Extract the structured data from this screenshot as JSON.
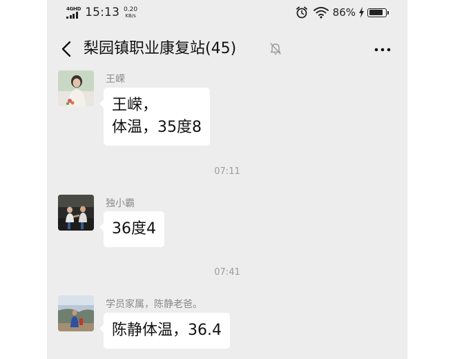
{
  "status_bar": {
    "network": "4GHD",
    "time": "15:13",
    "speed_value": "0.20",
    "speed_unit": "KB/s",
    "battery_percent": "86%",
    "battery_level": 0.86,
    "icons": [
      "signal-icon",
      "alarm-icon",
      "wifi-icon",
      "charging-icon",
      "battery-icon"
    ]
  },
  "nav": {
    "title": "梨园镇职业康复站(45)",
    "back_icon": "chevron-left-icon",
    "mute_icon": "bell-off-icon",
    "more_icon": "more-icon"
  },
  "messages": [
    {
      "sender": "王嵘",
      "line1": "王嵘，",
      "line2": "体温，35度8"
    },
    {
      "timestamp": "07:11",
      "sender": "独小霸",
      "text": "36度4"
    },
    {
      "timestamp": "07:41",
      "sender": "学员家属，陈静老爸。",
      "text": "陈静体温，36.4"
    }
  ],
  "colors": {
    "chat_background": "#ededed",
    "bubble": "#ffffff",
    "meta_text": "#8a8a8a"
  }
}
